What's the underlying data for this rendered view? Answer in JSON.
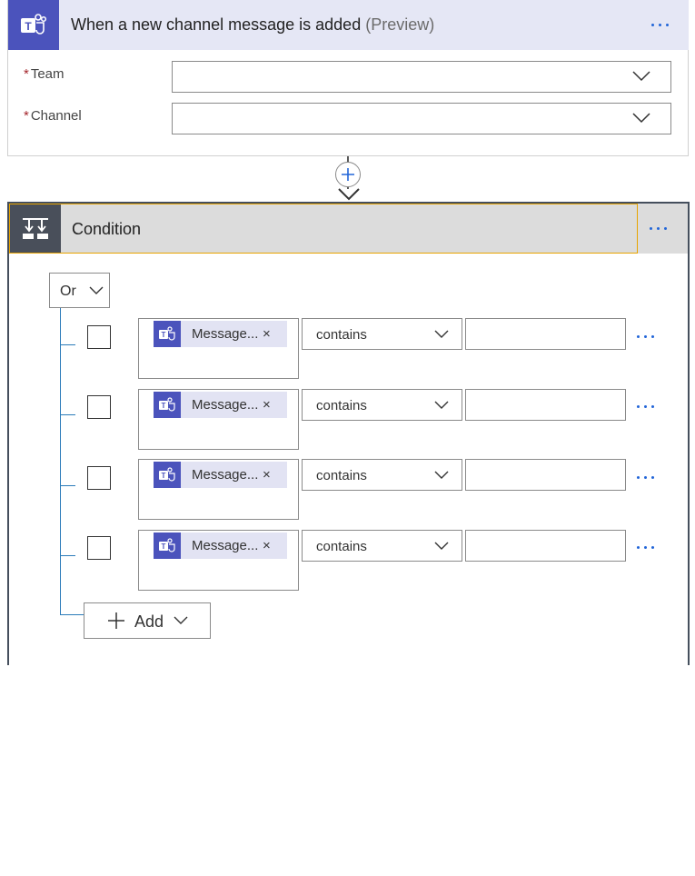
{
  "trigger": {
    "title": "When a new channel message is added",
    "suffix": "(Preview)",
    "icon": "teams-icon",
    "fields": [
      {
        "label": "Team",
        "required_mark": "*",
        "value": ""
      },
      {
        "label": "Channel",
        "required_mark": "*",
        "value": ""
      }
    ]
  },
  "connector": {
    "icon": "plus-icon"
  },
  "condition": {
    "title": "Condition",
    "icon": "condition-icon",
    "group_operator": "Or",
    "rows": [
      {
        "token": "Message...",
        "operator": "contains",
        "value": ""
      },
      {
        "token": "Message...",
        "operator": "contains",
        "value": ""
      },
      {
        "token": "Message...",
        "operator": "contains",
        "value": ""
      },
      {
        "token": "Message...",
        "operator": "contains",
        "value": ""
      }
    ],
    "token_remove": "×",
    "add_label": "Add"
  },
  "colors": {
    "teams_purple": "#4b53bc",
    "header_tint": "#e5e7f5",
    "condition_header": "#dcdcdc",
    "selected_border": "#e8a400",
    "more_dots": "#2266d8",
    "tree_line": "#2b7bb9"
  }
}
